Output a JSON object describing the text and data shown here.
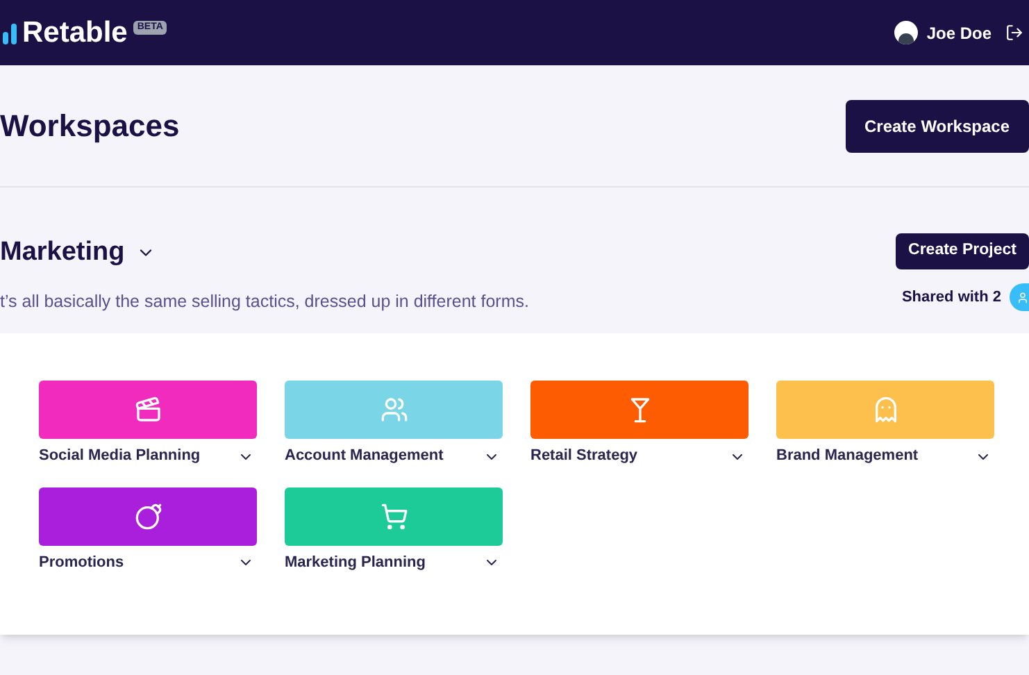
{
  "header": {
    "logo": "Retable",
    "badge": "BETA",
    "user": "Joe Doe"
  },
  "page": {
    "title": "Workspaces",
    "create_button": "Create Workspace"
  },
  "workspace": {
    "name": "Marketing",
    "description": "t’s all basically the same selling tactics, dressed up in different forms.",
    "create_button": "Create Project",
    "shared": "Shared with 2"
  },
  "projects": [
    {
      "name": "Social Media Planning",
      "color": "#f22bbf"
    },
    {
      "name": "Account Management",
      "color": "#7ad5e6"
    },
    {
      "name": "Retail Strategy",
      "color": "#fe5c02"
    },
    {
      "name": "Brand Management",
      "color": "#fec04c"
    },
    {
      "name": "Promotions",
      "color": "#aa1fdb"
    },
    {
      "name": "Marketing Planning",
      "color": "#1dcb98"
    }
  ]
}
